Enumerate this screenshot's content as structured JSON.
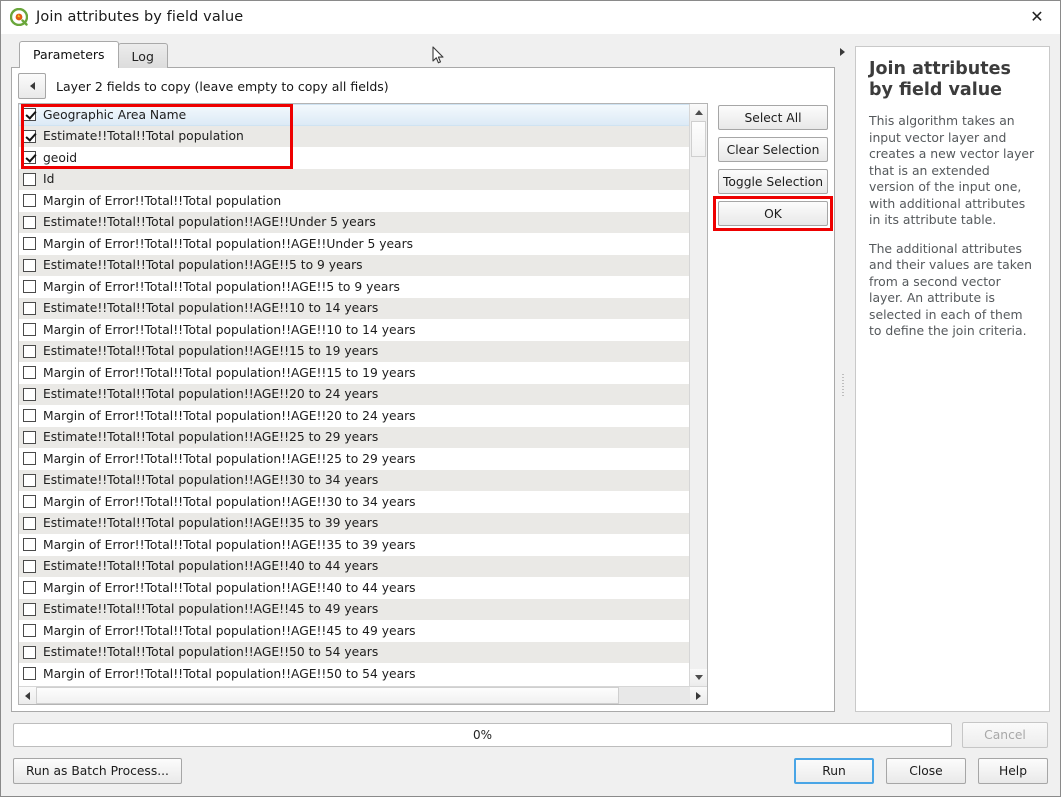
{
  "window": {
    "title": "Join attributes by field value",
    "app_icon": "qgis-logo-icon",
    "close_label": "✕"
  },
  "tabs": [
    {
      "label": "Parameters",
      "active": true
    },
    {
      "label": "Log",
      "active": false
    }
  ],
  "parameters": {
    "back_icon": "back-arrow-icon",
    "field_label": "Layer 2 fields to copy (leave empty to copy all fields)",
    "splitter_icon": "expand-right-icon"
  },
  "field_list": {
    "items": [
      {
        "label": "Geographic Area Name",
        "checked": true,
        "selected": true
      },
      {
        "label": "Estimate!!Total!!Total population",
        "checked": true,
        "selected": false
      },
      {
        "label": "geoid",
        "checked": true,
        "selected": false
      },
      {
        "label": "Id",
        "checked": false,
        "selected": false
      },
      {
        "label": "Margin of Error!!Total!!Total population",
        "checked": false,
        "selected": false
      },
      {
        "label": "Estimate!!Total!!Total population!!AGE!!Under 5 years",
        "checked": false,
        "selected": false
      },
      {
        "label": "Margin of Error!!Total!!Total population!!AGE!!Under 5 years",
        "checked": false,
        "selected": false
      },
      {
        "label": "Estimate!!Total!!Total population!!AGE!!5 to 9 years",
        "checked": false,
        "selected": false
      },
      {
        "label": "Margin of Error!!Total!!Total population!!AGE!!5 to 9 years",
        "checked": false,
        "selected": false
      },
      {
        "label": "Estimate!!Total!!Total population!!AGE!!10 to 14 years",
        "checked": false,
        "selected": false
      },
      {
        "label": "Margin of Error!!Total!!Total population!!AGE!!10 to 14 years",
        "checked": false,
        "selected": false
      },
      {
        "label": "Estimate!!Total!!Total population!!AGE!!15 to 19 years",
        "checked": false,
        "selected": false
      },
      {
        "label": "Margin of Error!!Total!!Total population!!AGE!!15 to 19 years",
        "checked": false,
        "selected": false
      },
      {
        "label": "Estimate!!Total!!Total population!!AGE!!20 to 24 years",
        "checked": false,
        "selected": false
      },
      {
        "label": "Margin of Error!!Total!!Total population!!AGE!!20 to 24 years",
        "checked": false,
        "selected": false
      },
      {
        "label": "Estimate!!Total!!Total population!!AGE!!25 to 29 years",
        "checked": false,
        "selected": false
      },
      {
        "label": "Margin of Error!!Total!!Total population!!AGE!!25 to 29 years",
        "checked": false,
        "selected": false
      },
      {
        "label": "Estimate!!Total!!Total population!!AGE!!30 to 34 years",
        "checked": false,
        "selected": false
      },
      {
        "label": "Margin of Error!!Total!!Total population!!AGE!!30 to 34 years",
        "checked": false,
        "selected": false
      },
      {
        "label": "Estimate!!Total!!Total population!!AGE!!35 to 39 years",
        "checked": false,
        "selected": false
      },
      {
        "label": "Margin of Error!!Total!!Total population!!AGE!!35 to 39 years",
        "checked": false,
        "selected": false
      },
      {
        "label": "Estimate!!Total!!Total population!!AGE!!40 to 44 years",
        "checked": false,
        "selected": false
      },
      {
        "label": "Margin of Error!!Total!!Total population!!AGE!!40 to 44 years",
        "checked": false,
        "selected": false
      },
      {
        "label": "Estimate!!Total!!Total population!!AGE!!45 to 49 years",
        "checked": false,
        "selected": false
      },
      {
        "label": "Margin of Error!!Total!!Total population!!AGE!!45 to 49 years",
        "checked": false,
        "selected": false
      },
      {
        "label": "Estimate!!Total!!Total population!!AGE!!50 to 54 years",
        "checked": false,
        "selected": false
      },
      {
        "label": "Margin of Error!!Total!!Total population!!AGE!!50 to 54 years",
        "checked": false,
        "selected": false
      }
    ]
  },
  "list_buttons": {
    "select_all": "Select All",
    "clear_selection": "Clear Selection",
    "toggle_selection": "Toggle Selection",
    "ok": "OK"
  },
  "help": {
    "title": "Join attributes by field value",
    "paragraphs": [
      "This algorithm takes an input vector layer and creates a new vector layer that is an extended version of the input one, with additional attributes in its attribute table.",
      "The additional attributes and their values are taken from a second vector layer. An attribute is selected in each of them to define the join criteria."
    ]
  },
  "progress": {
    "percent_label": "0%",
    "cancel_label": "Cancel"
  },
  "footer": {
    "batch_label": "Run as Batch Process...",
    "run_label": "Run",
    "close_label": "Close",
    "help_label": "Help"
  },
  "highlight": {
    "color": "#ee0000",
    "targets": [
      "checked-fields-group",
      "ok-button"
    ]
  }
}
